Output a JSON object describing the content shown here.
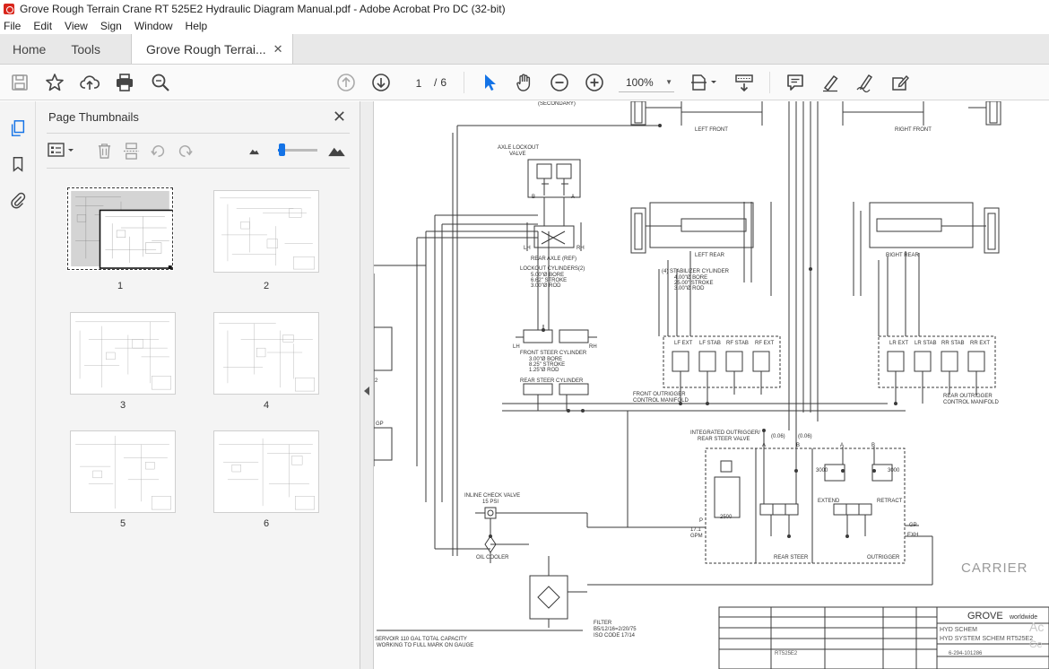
{
  "window": {
    "title": "Grove Rough Terrain Crane RT 525E2 Hydraulic Diagram Manual.pdf - Adobe Acrobat Pro DC (32-bit)"
  },
  "menu": [
    "File",
    "Edit",
    "View",
    "Sign",
    "Window",
    "Help"
  ],
  "tabs": {
    "home": "Home",
    "tools": "Tools",
    "document": "Grove Rough Terrai...",
    "close_glyph": "✕"
  },
  "toolbar": {
    "current_page": "1",
    "page_separator": "/",
    "total_pages": "6",
    "zoom": "100%"
  },
  "panel": {
    "title": "Page Thumbnails",
    "pages": [
      "1",
      "2",
      "3",
      "4",
      "5",
      "6"
    ],
    "selected_page": "1",
    "slider_level": 0.1
  },
  "colors": {
    "accent": "#1473e6",
    "adobe_red": "#d9261c",
    "line": "#3a3a3a"
  },
  "diagram": {
    "secondary": "(SECONDARY)",
    "left_front": "LEFT FRONT",
    "right_front": "RIGHT FRONT",
    "axle_lockout_valve": [
      "AXLE LOCKOUT",
      "VALVE"
    ],
    "port_b": "B",
    "port_a": "A",
    "lh": "LH",
    "rh": "RH",
    "rear_axle": "REAR AXLE (REF)",
    "lockout_cylinders": [
      "LOCKOUT CYLINDERS(2)",
      "5.00\"Ø BORE",
      "6.62\" STROKE",
      "3.00\"Ø ROD"
    ],
    "left_rear": "LEFT REAR",
    "right_rear": "RIGHT REAR",
    "stabilizer": [
      "(4) STABILIZER CYLINDER",
      "4.00\"Ø BORE",
      "25.00\" STROKE",
      "3.00\"Ø ROD"
    ],
    "front_steer": [
      "FRONT STEER CYLINDER",
      "3.00\"Ø BORE",
      "8.25\" STROKE",
      "1.25\"Ø ROD"
    ],
    "rear_steer_cyl": "REAR STEER CYLINDER",
    "lf_labels": [
      "LF EXT",
      "LF STAB",
      "RF STAB",
      "RF EXT"
    ],
    "lr_labels": [
      "LR EXT",
      "LR STAB",
      "RR STAB",
      "RR EXT"
    ],
    "front_outrigger": [
      "FRONT OUTRIGGER",
      "CONTROL MANIFOLD"
    ],
    "rear_outrigger": [
      "REAR OUTRIGGER",
      "CONTROL MANIFOLD"
    ],
    "integrated_valve": [
      "INTEGRATED OUTRIGGER/",
      "REAR STEER VALVE"
    ],
    "orifice": "(0.06)",
    "relief_3000": "3000",
    "relief_2500": "2500",
    "extend": "EXTEND",
    "retract": "RETRACT",
    "port_p": "P",
    "gpm": [
      "17.1",
      "GPM"
    ],
    "port_gp": "GP",
    "port_exh": "EXH",
    "rear_steer_sec": "REAR STEER",
    "outrigger_sec": "OUTRIGGER",
    "carrier": "CARRIER",
    "inline_check": [
      "INLINE CHECK VALVE",
      "15 PSI"
    ],
    "oil_cooler": "OIL COOLER",
    "filter": [
      "FILTER",
      "B5/12/16=2/20/75",
      "ISO CODE 17/14"
    ],
    "reservoir": [
      "SERVOIR 110 GAL TOTAL CAPACITY",
      "WORKING TO FULL MARK ON GAUGE"
    ],
    "gp_left": "GP",
    "num_2": "2",
    "grove": "GROVE",
    "worldwide": "worldwide",
    "title_block": [
      "HYD SCHEM",
      "HYD SYSTEM SCHEM RT525E2"
    ],
    "drawing_no": "6-294-101286",
    "model": "RT525E2",
    "acr": "Ac",
    "ge": "Ge"
  }
}
